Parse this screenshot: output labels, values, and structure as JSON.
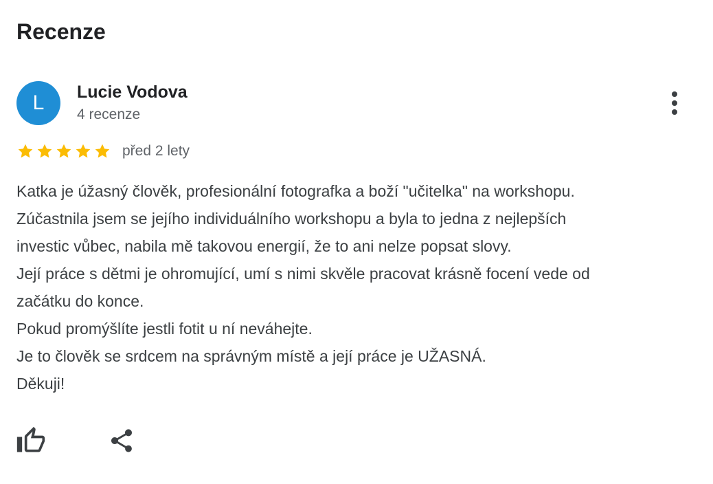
{
  "section": {
    "title": "Recenze"
  },
  "review": {
    "avatar_letter": "L",
    "author_name": "Lucie Vodova",
    "author_reviews": "4 recenze",
    "rating": 5,
    "rating_max": 5,
    "date": "před 2 lety",
    "text_lines": [
      "Katka je úžasný člověk, profesionální fotografka a boží \"učitelka\" na workshopu.",
      "Zúčastnila jsem se jejího individuálního workshopu a byla to jedna z nejlepších",
      "investic vůbec, nabila mě takovou energií, že to ani nelze popsat slovy.",
      "Její práce s dětmi je ohromující, umí s nimi skvěle pracovat krásně focení vede od",
      "začátku do konce.",
      "Pokud promýšlíte jestli fotit u ní neváhejte.",
      "Je to člověk se srdcem na správným místě a její práce je UŽASNÁ.",
      "Děkuji!"
    ]
  },
  "colors": {
    "avatar": "#1f8ed5",
    "star": "#fbbc04",
    "icon": "#3c4043",
    "meta_text": "#5f6368"
  },
  "icons": {
    "more": "more-vertical-icon",
    "like": "thumb-up-icon",
    "share": "share-icon",
    "star": "star-icon"
  }
}
